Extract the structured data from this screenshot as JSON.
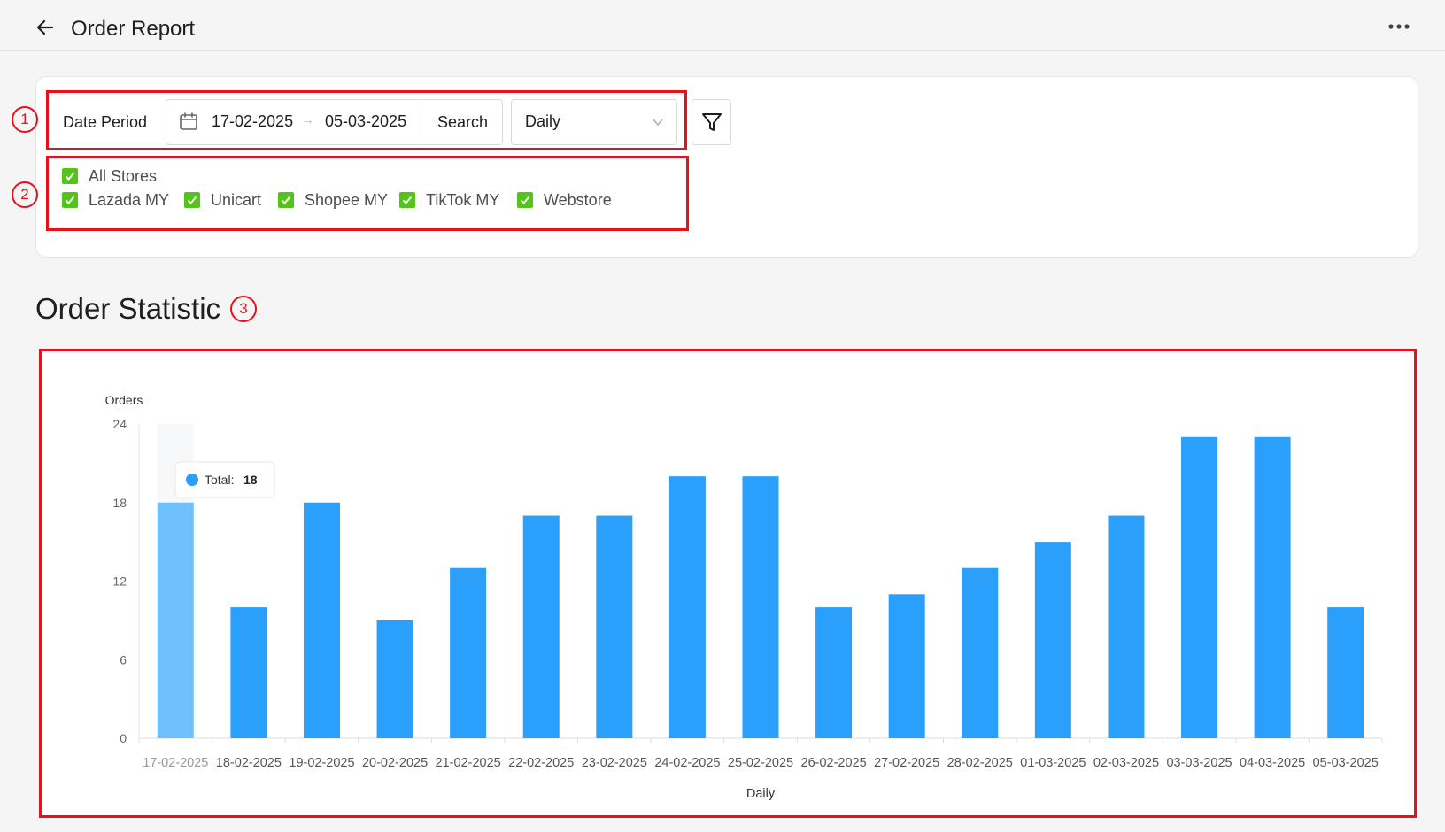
{
  "header": {
    "title": "Order Report",
    "back_icon": "arrow-left-icon",
    "more_icon": "more-horizontal-icon"
  },
  "filters": {
    "date_label": "Date Period",
    "date_from": "17-02-2025",
    "date_to": "05-03-2025",
    "range_separator": "→",
    "search_label": "Search",
    "period_value": "Daily",
    "calendar_icon": "calendar-icon",
    "filter_icon": "filter-icon",
    "stores": [
      {
        "label": "All Stores",
        "checked": true
      },
      {
        "label": "Lazada MY",
        "checked": true
      },
      {
        "label": "Unicart",
        "checked": true
      },
      {
        "label": "Shopee MY",
        "checked": true
      },
      {
        "label": "TikTok MY",
        "checked": true
      },
      {
        "label": "Webstore",
        "checked": true
      }
    ]
  },
  "annotations": {
    "marker1": "1",
    "marker2": "2",
    "marker3": "3",
    "color": "#e8101a"
  },
  "section": {
    "title": "Order Statistic"
  },
  "chart_data": {
    "type": "bar",
    "ylabel": "Orders",
    "xlabel": "Daily",
    "ylim": [
      0,
      24
    ],
    "yticks": [
      0,
      6,
      12,
      18,
      24
    ],
    "categories": [
      "17-02-2025",
      "18-02-2025",
      "19-02-2025",
      "20-02-2025",
      "21-02-2025",
      "22-02-2025",
      "23-02-2025",
      "24-02-2025",
      "25-02-2025",
      "26-02-2025",
      "27-02-2025",
      "28-02-2025",
      "01-03-2025",
      "02-03-2025",
      "03-03-2025",
      "04-03-2025",
      "05-03-2025"
    ],
    "values": [
      18,
      10,
      18,
      9,
      13,
      17,
      17,
      20,
      20,
      10,
      11,
      13,
      15,
      17,
      23,
      23,
      10
    ],
    "bar_color": "#2b9ffc",
    "highlight_color": "#6ec1fd",
    "highlight_index": 0,
    "tooltip": {
      "label": "Total:",
      "value": "18"
    },
    "grid": false
  }
}
